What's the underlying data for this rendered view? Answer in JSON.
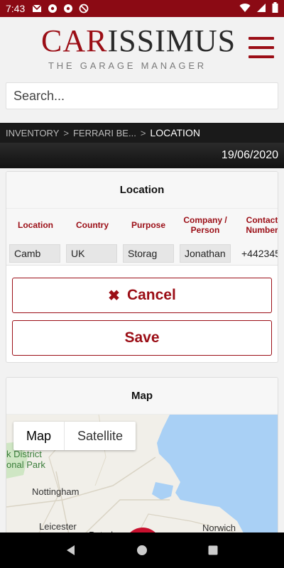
{
  "status_bar": {
    "time": "7:43",
    "left_icons": [
      "gmail-icon",
      "soccer-ball-icon",
      "soccer-ball-icon",
      "no-disturb-icon"
    ],
    "right_icons": [
      "wifi-icon",
      "signal-icon",
      "battery-icon"
    ]
  },
  "header": {
    "logo_car": "CAR",
    "logo_issimus": "ISSIMUS",
    "logo_tagline": "THE GARAGE MANAGER"
  },
  "search": {
    "placeholder": "Search..."
  },
  "breadcrumb": {
    "items": [
      "INVENTORY",
      "FERRARI BE...",
      "LOCATION"
    ],
    "separator": ">"
  },
  "date": "19/06/2020",
  "location_card": {
    "title": "Location",
    "columns": [
      "Location",
      "Country",
      "Purpose",
      "Company / Person",
      "Contact Number"
    ],
    "row": [
      "Camb",
      "UK",
      "Storag",
      "Jonathan",
      "+442345"
    ],
    "cancel_label": "Cancel",
    "save_label": "Save"
  },
  "map_card": {
    "title": "Map",
    "tabs": [
      "Map",
      "Satellite"
    ],
    "labels": [
      "k District",
      "onal Park",
      "Nottingham",
      "Leicester",
      "Peterbor",
      "Norwich"
    ]
  },
  "colors": {
    "brand": "#9b0e16",
    "status_bar": "#8b0a14",
    "sea": "#a9d0f5"
  }
}
